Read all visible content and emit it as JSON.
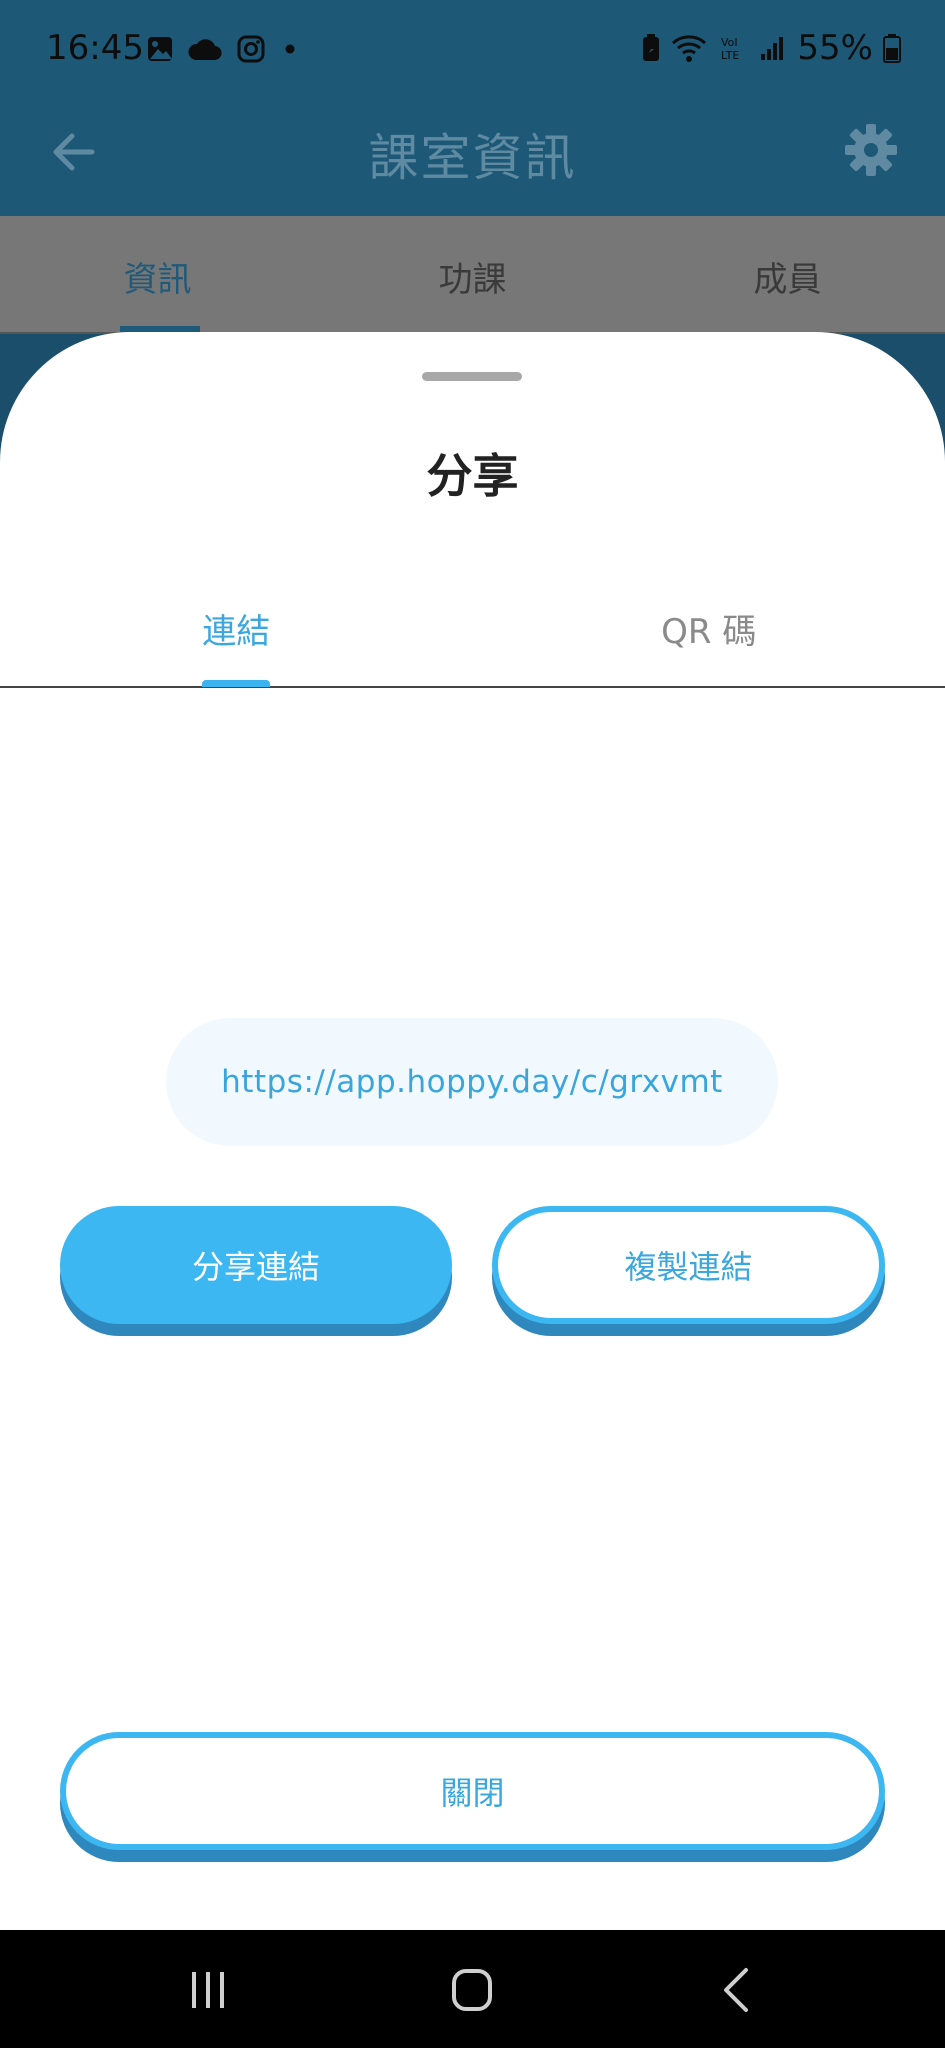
{
  "status_bar": {
    "time": "16:45",
    "battery": "55%",
    "icons": [
      "image-icon",
      "cloud-icon",
      "instagram-icon",
      "dot-icon",
      "battery-saver-icon",
      "wifi-icon",
      "volte-icon",
      "signal-icon",
      "battery-icon"
    ]
  },
  "app_bar": {
    "title": "課室資訊",
    "back_icon": "arrow-left-icon",
    "settings_icon": "gear-icon"
  },
  "top_tabs": [
    {
      "label": "資訊",
      "active": true
    },
    {
      "label": "功課",
      "active": false
    },
    {
      "label": "成員",
      "active": false
    }
  ],
  "sheet": {
    "title": "分享",
    "tabs": [
      {
        "label": "連結",
        "active": true
      },
      {
        "label": "QR 碼",
        "active": false
      }
    ],
    "link": "https://app.hoppy.day/c/grxvmt",
    "share_button": "分享連結",
    "copy_button": "複製連結",
    "close_button": "關閉"
  },
  "colors": {
    "accent": "#3db7f1",
    "accent_shadow": "#2f88bd",
    "app_bar": "#1d5877"
  },
  "nav_bar": {
    "items": [
      "recents-icon",
      "home-icon",
      "back-icon"
    ]
  }
}
